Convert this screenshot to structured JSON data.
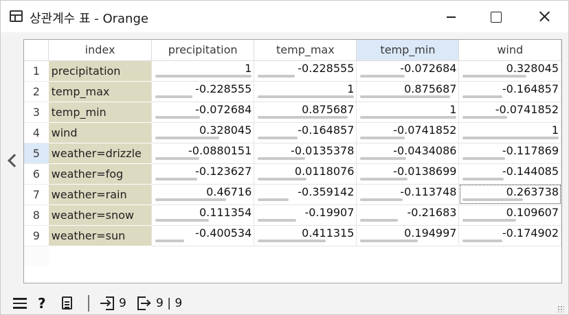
{
  "window": {
    "title": "상관계수 표 - Orange"
  },
  "table": {
    "columns": [
      "index",
      "precipitation",
      "temp_max",
      "temp_min",
      "wind"
    ],
    "selected_column": 3,
    "selected_row": 4,
    "focused_cell": {
      "row": 6,
      "col": 3
    },
    "rows": [
      {
        "num": "1",
        "label": "precipitation",
        "values": [
          "1",
          "-0.228555",
          "-0.072684",
          "0.328045"
        ],
        "raw": [
          1,
          -0.228555,
          -0.072684,
          0.328045
        ]
      },
      {
        "num": "2",
        "label": "temp_max",
        "values": [
          "-0.228555",
          "1",
          "0.875687",
          "-0.164857"
        ],
        "raw": [
          -0.228555,
          1,
          0.875687,
          -0.164857
        ]
      },
      {
        "num": "3",
        "label": "temp_min",
        "values": [
          "-0.072684",
          "0.875687",
          "1",
          "-0.0741852"
        ],
        "raw": [
          -0.072684,
          0.875687,
          1,
          -0.0741852
        ]
      },
      {
        "num": "4",
        "label": "wind",
        "values": [
          "0.328045",
          "-0.164857",
          "-0.0741852",
          "1"
        ],
        "raw": [
          0.328045,
          -0.164857,
          -0.0741852,
          1
        ]
      },
      {
        "num": "5",
        "label": "weather=drizzle",
        "values": [
          "-0.0880151",
          "-0.0135378",
          "-0.0434086",
          "-0.117869"
        ],
        "raw": [
          -0.0880151,
          -0.0135378,
          -0.0434086,
          -0.117869
        ]
      },
      {
        "num": "6",
        "label": "weather=fog",
        "values": [
          "-0.123627",
          "0.0118076",
          "-0.0138699",
          "-0.144085"
        ],
        "raw": [
          -0.123627,
          0.0118076,
          -0.0138699,
          -0.144085
        ]
      },
      {
        "num": "7",
        "label": "weather=rain",
        "values": [
          "0.46716",
          "-0.359142",
          "-0.113748",
          "0.263738"
        ],
        "raw": [
          0.46716,
          -0.359142,
          -0.113748,
          0.263738
        ]
      },
      {
        "num": "8",
        "label": "weather=snow",
        "values": [
          "0.111354",
          "-0.19907",
          "-0.21683",
          "0.109607"
        ],
        "raw": [
          0.111354,
          -0.19907,
          -0.21683,
          0.109607
        ]
      },
      {
        "num": "9",
        "label": "weather=sun",
        "values": [
          "-0.400534",
          "0.411315",
          "0.194997",
          "-0.174902"
        ],
        "raw": [
          -0.400534,
          0.411315,
          0.194997,
          -0.174902
        ]
      }
    ]
  },
  "statusbar": {
    "help_glyph": "?",
    "input_count": "9",
    "output_count": "9 | 9"
  },
  "icons": {
    "menu": "hamburger-menu-icon",
    "help": "help-icon",
    "report": "report-document-icon",
    "input": "input-arrow-icon",
    "output": "output-arrow-icon"
  }
}
